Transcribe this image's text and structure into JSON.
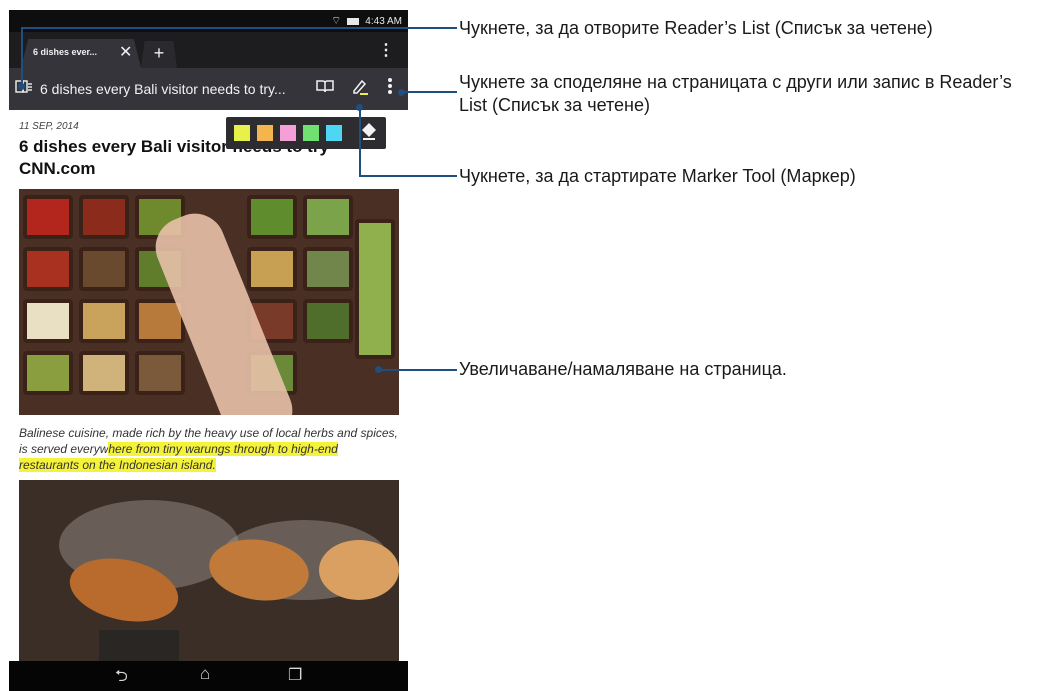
{
  "status_bar": {
    "time": "4:43 AM",
    "wifi_icon": "wifi-icon",
    "battery_icon": "battery-icon"
  },
  "browser": {
    "tab": {
      "title": "6 dishes ever...",
      "close": "✕"
    },
    "new_tab": "+",
    "tab_menu": "⋮",
    "page_title": "6 dishes every Bali visitor needs to try...",
    "toolbar_icons": [
      "readers-list-icon",
      "book-icon",
      "marker-icon",
      "overflow-menu-icon"
    ],
    "marker_palette": {
      "colors": [
        "#e7f14a",
        "#f4b54e",
        "#f59fd9",
        "#6fe071",
        "#4fd6f2"
      ],
      "eraser_icon": "eraser-icon"
    }
  },
  "article": {
    "date": "11 SEP, 2014",
    "title": "6 dishes every Bali visitor needs to try CNN.com",
    "caption_plain": "Balinese cuisine, made rich by the heavy use of local herbs and spices, is served everyw",
    "caption_highlighted": "here from tiny warungs through to high-end restaurants on the Indonesian island."
  },
  "nav_bar": {
    "back": "⮌",
    "home": "⌂",
    "recent": "❐"
  },
  "callouts": {
    "readers_list": "Чукнете, за да отворите Reader’s List (Списък за четене)",
    "share": "Чукнете за споделяне на страницата с други или запис в Reader’s List (Списък за четене)",
    "marker": "Чукнете, за да стартирате Marker Tool (Маркер)",
    "zoom": "Увеличаване/намаляване на страница."
  }
}
